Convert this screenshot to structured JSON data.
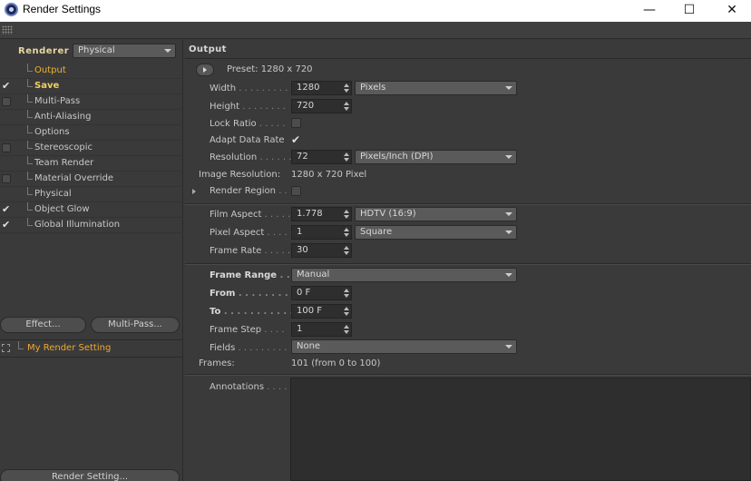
{
  "window": {
    "title": "Render Settings",
    "minimize": "—",
    "maximize": "☐",
    "close": "✕"
  },
  "left": {
    "renderer_label": "Renderer",
    "renderer_value": "Physical",
    "items": [
      {
        "label": "Output",
        "check": "",
        "style": "active"
      },
      {
        "label": "Save",
        "check": "✔",
        "style": "bold"
      },
      {
        "label": "Multi-Pass",
        "check": "box",
        "style": ""
      },
      {
        "label": "Anti-Aliasing",
        "check": "",
        "style": ""
      },
      {
        "label": "Options",
        "check": "",
        "style": ""
      },
      {
        "label": "Stereoscopic",
        "check": "box",
        "style": ""
      },
      {
        "label": "Team Render",
        "check": "",
        "style": ""
      },
      {
        "label": "Material Override",
        "check": "box",
        "style": ""
      },
      {
        "label": "Physical",
        "check": "",
        "style": ""
      },
      {
        "label": "Object Glow",
        "check": "✔",
        "style": ""
      },
      {
        "label": "Global Illumination",
        "check": "✔",
        "style": ""
      }
    ],
    "effect_button": "Effect...",
    "multipass_button": "Multi-Pass...",
    "setting_name": "My Render Setting",
    "render_setting_button": "Render Setting..."
  },
  "output": {
    "header": "Output",
    "preset": "Preset: 1280 x 720",
    "width_label": "Width",
    "width_value": "1280",
    "width_unit": "Pixels",
    "height_label": "Height",
    "height_value": "720",
    "lock_ratio_label": "Lock Ratio",
    "adapt_label": "Adapt Data Rate",
    "adapt_check": "✔",
    "resolution_label": "Resolution",
    "resolution_value": "72",
    "resolution_unit": "Pixels/Inch (DPI)",
    "image_res_label": "Image Resolution:",
    "image_res_value": "1280 x 720 Pixel",
    "render_region_label": "Render Region",
    "film_aspect_label": "Film Aspect",
    "film_aspect_value": "1.778",
    "film_aspect_preset": "HDTV (16:9)",
    "pixel_aspect_label": "Pixel Aspect",
    "pixel_aspect_value": "1",
    "pixel_aspect_preset": "Square",
    "frame_rate_label": "Frame Rate",
    "frame_rate_value": "30",
    "frame_range_label": "Frame Range",
    "frame_range_value": "Manual",
    "from_label": "From",
    "from_value": "0 F",
    "to_label": "To",
    "to_value": "100 F",
    "frame_step_label": "Frame Step",
    "frame_step_value": "1",
    "fields_label": "Fields",
    "fields_value": "None",
    "frames_label": "Frames:",
    "frames_value": "101 (from 0 to 100)",
    "annotations_label": "Annotations"
  }
}
